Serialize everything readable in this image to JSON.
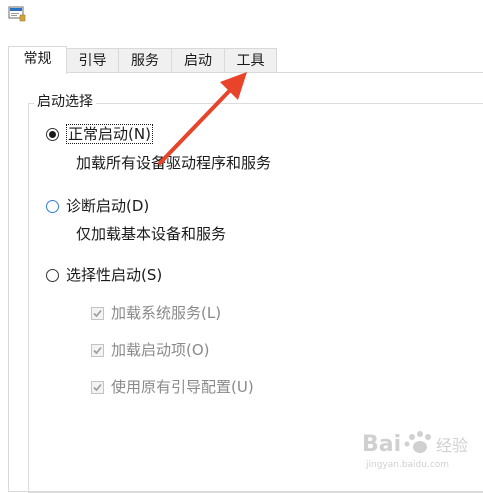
{
  "tabs": [
    {
      "label": "常规",
      "active": true
    },
    {
      "label": "引导"
    },
    {
      "label": "服务"
    },
    {
      "label": "启动"
    },
    {
      "label": "工具"
    }
  ],
  "startup_group": {
    "title": "启动选择",
    "normal": {
      "label": "正常启动(N)",
      "description": "加载所有设备驱动程序和服务",
      "selected": true
    },
    "diagnostic": {
      "label": "诊断启动(D)",
      "description": "仅加载基本设备和服务"
    },
    "selective": {
      "label": "选择性启动(S)",
      "options": [
        {
          "label": "加载系统服务(L)",
          "checked": true
        },
        {
          "label": "加载启动项(O)",
          "checked": true
        },
        {
          "label": "使用原有引导配置(U)",
          "checked": true
        }
      ]
    }
  },
  "colors": {
    "annotation_arrow": "#e8432b",
    "tab_border": "#d9d9d9",
    "disabled_text": "#8a8a8a"
  },
  "watermark": {
    "name": "baidu-jingyan-watermark",
    "text": "Bai 经验",
    "subtext": "jingyan.baidu.com"
  }
}
